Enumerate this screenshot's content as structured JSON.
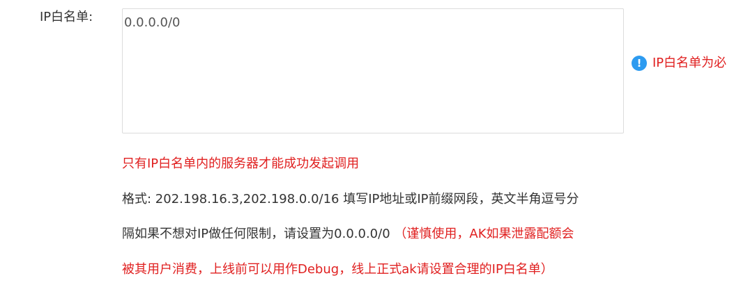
{
  "form": {
    "ip_whitelist_label": "IP白名单:",
    "ip_whitelist_value": "0.0.0.0/0",
    "required_hint": "IP白名单为必",
    "hint_icon": "exclamation-circle-icon",
    "hint_icon_glyph": "!",
    "notice": "只有IP白名单内的服务器才能成功发起调用",
    "format_line_1": "格式: 202.198.16.3,202.198.0.0/16 填写IP地址或IP前缀网段，英文半角逗号分",
    "format_line_2": "隔如果不想对IP做任何限制，请设置为0.0.0.0/0",
    "warning_line_1": "（谨慎使用，AK如果泄露配额会",
    "warning_line_2": "被其用户消费，上线前可以用作Debug，线上正式ak请设置合理的IP白名单）"
  },
  "colors": {
    "warning_red": "#e02020",
    "hint_icon_blue": "#2d9bf0",
    "text_dark": "#333333",
    "border": "#dcdcdc"
  }
}
